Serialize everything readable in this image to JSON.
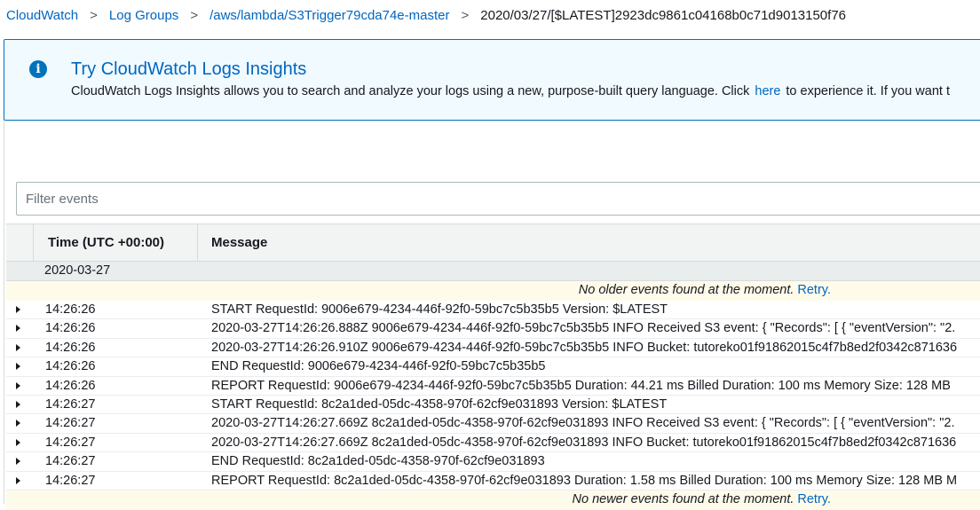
{
  "breadcrumb": {
    "items": [
      "CloudWatch",
      "Log Groups",
      "/aws/lambda/S3Trigger79cda74e-master"
    ],
    "current": "2020/03/27/[$LATEST]2923dc9861c04168b0c71d9013150f76"
  },
  "info": {
    "title": "Try CloudWatch Logs Insights",
    "text_before": "CloudWatch Logs Insights allows you to search and analyze your logs using a new, purpose-built query language. Click",
    "link": "here",
    "text_after": "to experience it. If you want t"
  },
  "filter": {
    "placeholder": "Filter events"
  },
  "table": {
    "headers": {
      "time": "Time (UTC +00:00)",
      "message": "Message"
    },
    "date": "2020-03-27",
    "no_older": "No older events found at the moment.",
    "no_newer": "No newer events found at the moment.",
    "retry": "Retry.",
    "rows": [
      {
        "time": "14:26:26",
        "message": "START RequestId: 9006e679-4234-446f-92f0-59bc7c5b35b5 Version: $LATEST"
      },
      {
        "time": "14:26:26",
        "message": "2020-03-27T14:26:26.888Z 9006e679-4234-446f-92f0-59bc7c5b35b5 INFO Received S3 event: { \"Records\": [ { \"eventVersion\": \"2."
      },
      {
        "time": "14:26:26",
        "message": "2020-03-27T14:26:26.910Z 9006e679-4234-446f-92f0-59bc7c5b35b5 INFO Bucket: tutoreko01f91862015c4f7b8ed2f0342c871636"
      },
      {
        "time": "14:26:26",
        "message": "END RequestId: 9006e679-4234-446f-92f0-59bc7c5b35b5"
      },
      {
        "time": "14:26:26",
        "message": "REPORT RequestId: 9006e679-4234-446f-92f0-59bc7c5b35b5 Duration: 44.21 ms Billed Duration: 100 ms Memory Size: 128 MB"
      },
      {
        "time": "14:26:27",
        "message": "START RequestId: 8c2a1ded-05dc-4358-970f-62cf9e031893 Version: $LATEST"
      },
      {
        "time": "14:26:27",
        "message": "2020-03-27T14:26:27.669Z 8c2a1ded-05dc-4358-970f-62cf9e031893 INFO Received S3 event: { \"Records\": [ { \"eventVersion\": \"2."
      },
      {
        "time": "14:26:27",
        "message": "2020-03-27T14:26:27.669Z 8c2a1ded-05dc-4358-970f-62cf9e031893 INFO Bucket: tutoreko01f91862015c4f7b8ed2f0342c871636"
      },
      {
        "time": "14:26:27",
        "message": "END RequestId: 8c2a1ded-05dc-4358-970f-62cf9e031893"
      },
      {
        "time": "14:26:27",
        "message": "REPORT RequestId: 8c2a1ded-05dc-4358-970f-62cf9e031893 Duration: 1.58 ms Billed Duration: 100 ms Memory Size: 128 MB M"
      }
    ]
  },
  "colors": {
    "link": "#0066c0",
    "info_bg": "#f1faff",
    "info_border": "#0073bb",
    "notice_bg": "#fffbea"
  }
}
